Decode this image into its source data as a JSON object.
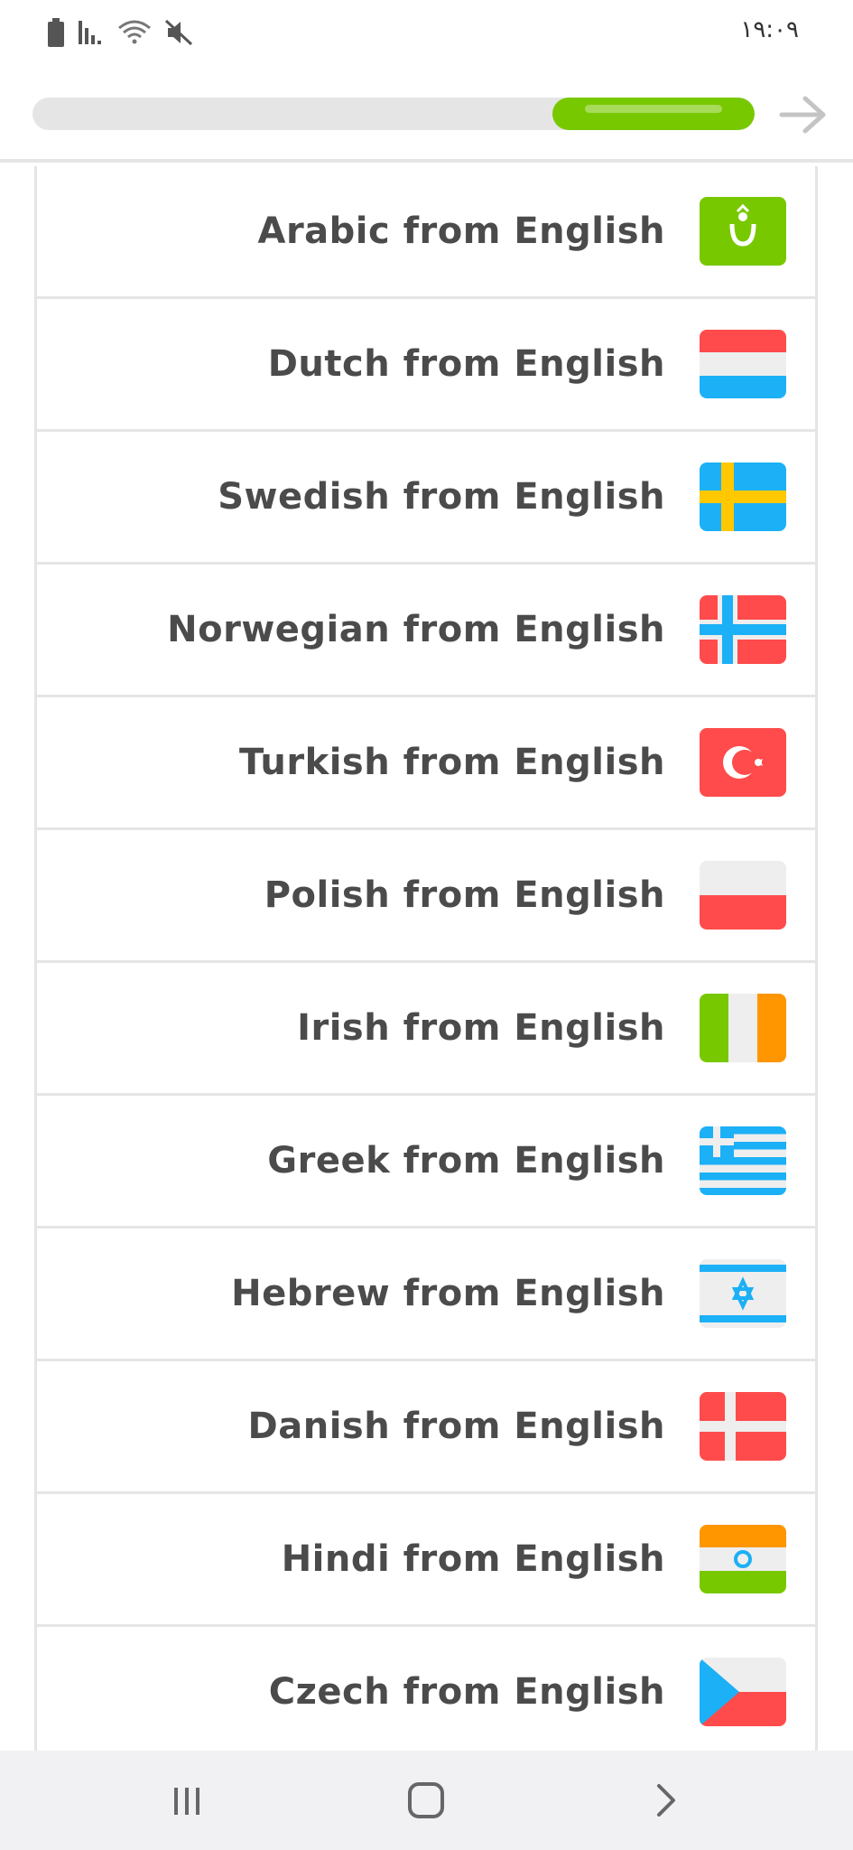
{
  "status_bar": {
    "time": "١٩:٠٩",
    "icons": [
      "battery-icon",
      "signal-icon",
      "wifi-icon",
      "mute-icon"
    ]
  },
  "header": {
    "progress": 0.72,
    "colors": {
      "fill": "#78c800",
      "track": "#e5e5e5"
    },
    "next_icon": "arrow-right-icon"
  },
  "courses": [
    {
      "label": "Arabic from English",
      "flag": "arabic-flag-icon"
    },
    {
      "label": "Dutch from English",
      "flag": "dutch-flag-icon"
    },
    {
      "label": "Swedish from English",
      "flag": "swedish-flag-icon"
    },
    {
      "label": "Norwegian from English",
      "flag": "norwegian-flag-icon"
    },
    {
      "label": "Turkish from English",
      "flag": "turkish-flag-icon"
    },
    {
      "label": "Polish from English",
      "flag": "polish-flag-icon"
    },
    {
      "label": "Irish from English",
      "flag": "irish-flag-icon"
    },
    {
      "label": "Greek from English",
      "flag": "greek-flag-icon"
    },
    {
      "label": "Hebrew from English",
      "flag": "hebrew-flag-icon"
    },
    {
      "label": "Danish from English",
      "flag": "danish-flag-icon"
    },
    {
      "label": "Hindi from English",
      "flag": "hindi-flag-icon"
    },
    {
      "label": "Czech from English",
      "flag": "czech-flag-icon"
    }
  ],
  "nav_bar": {
    "icons": [
      "recent-apps-icon",
      "home-icon",
      "back-icon"
    ]
  }
}
